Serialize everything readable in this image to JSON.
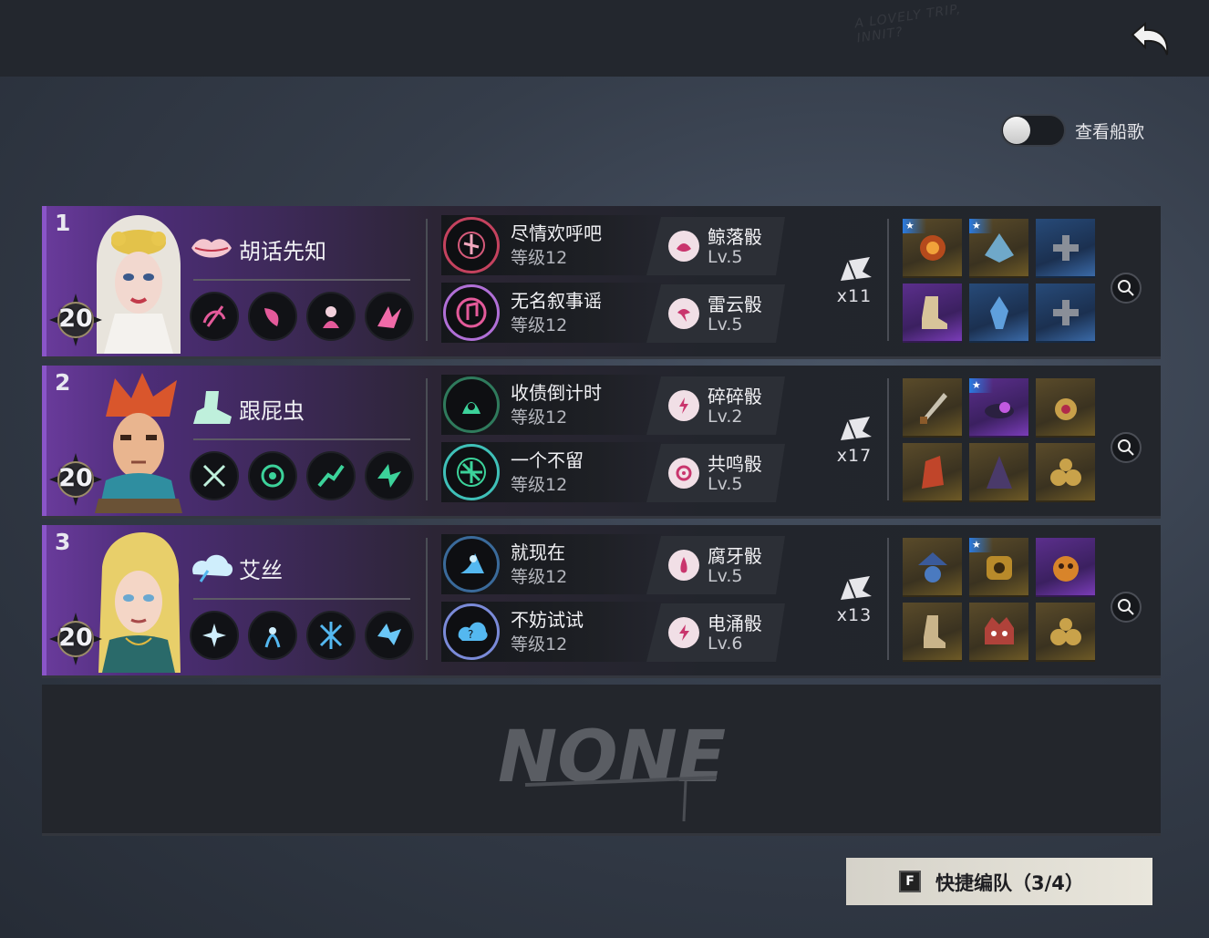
{
  "header": {
    "scribble": "A LOVELY TRIP, INNIT?",
    "back_icon": "back-arrow-icon"
  },
  "toggle": {
    "label": "查看船歌",
    "on": false
  },
  "slots": [
    {
      "number": "1",
      "level": "20",
      "name": "胡话先知",
      "class_icon": "lips-icon",
      "accent": "#e45a9a",
      "songs": [
        {
          "name": "尽情欢呼吧",
          "level": "等级12"
        },
        {
          "name": "无名叙事谣",
          "level": "等级12"
        }
      ],
      "dice": [
        {
          "name": "鲸落骰",
          "level": "Lv.5"
        },
        {
          "name": "雷云骰",
          "level": "Lv.5"
        }
      ],
      "shell_count": "x11",
      "equipment": [
        {
          "rarity": "gold",
          "starred": true
        },
        {
          "rarity": "gold",
          "starred": true
        },
        {
          "rarity": "blue",
          "starred": false
        },
        {
          "rarity": "purple",
          "starred": false
        },
        {
          "rarity": "blue",
          "starred": false
        },
        {
          "rarity": "blue",
          "starred": false
        }
      ]
    },
    {
      "number": "2",
      "level": "20",
      "name": "跟屁虫",
      "class_icon": "boot-icon",
      "accent": "#3cd29a",
      "songs": [
        {
          "name": "收债倒计时",
          "level": "等级12"
        },
        {
          "name": "一个不留",
          "level": "等级12"
        }
      ],
      "dice": [
        {
          "name": "碎碎骰",
          "level": "Lv.2"
        },
        {
          "name": "共鸣骰",
          "level": "Lv.5"
        }
      ],
      "shell_count": "x17",
      "equipment": [
        {
          "rarity": "gold",
          "starred": false
        },
        {
          "rarity": "purple",
          "starred": true
        },
        {
          "rarity": "gold",
          "starred": false
        },
        {
          "rarity": "gold",
          "starred": false
        },
        {
          "rarity": "gold",
          "starred": false
        },
        {
          "rarity": "gold",
          "starred": false
        }
      ]
    },
    {
      "number": "3",
      "level": "20",
      "name": "艾丝",
      "class_icon": "cloud-icon",
      "accent": "#54b8f0",
      "songs": [
        {
          "name": "就现在",
          "level": "等级12"
        },
        {
          "name": "不妨试试",
          "level": "等级12"
        }
      ],
      "dice": [
        {
          "name": "腐牙骰",
          "level": "Lv.5"
        },
        {
          "name": "电涌骰",
          "level": "Lv.6"
        }
      ],
      "shell_count": "x13",
      "equipment": [
        {
          "rarity": "gold",
          "starred": false
        },
        {
          "rarity": "gold",
          "starred": true
        },
        {
          "rarity": "purple",
          "starred": false
        },
        {
          "rarity": "gold",
          "starred": false
        },
        {
          "rarity": "gold",
          "starred": false
        },
        {
          "rarity": "gold",
          "starred": false
        }
      ]
    }
  ],
  "empty_slot": {
    "label": "NONE"
  },
  "quick_team": {
    "key": "F",
    "label": "快捷编队（3/4）"
  }
}
